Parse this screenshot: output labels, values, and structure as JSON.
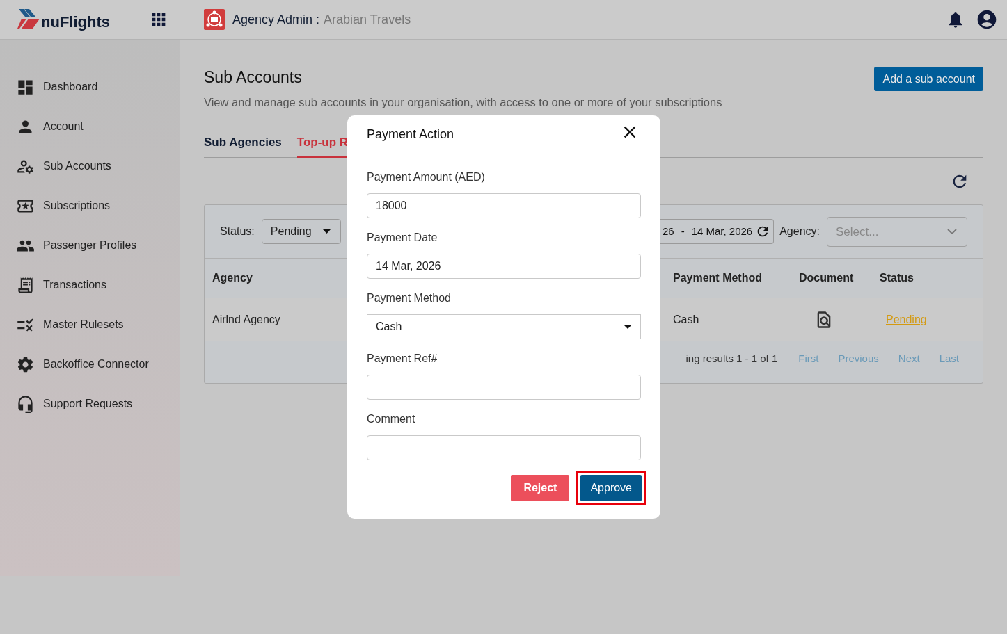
{
  "header": {
    "logo": "nuFlights",
    "title": "Agency Admin :",
    "agency": "Arabian Travels"
  },
  "sidebar": {
    "items": [
      {
        "label": "Dashboard"
      },
      {
        "label": "Account"
      },
      {
        "label": "Sub Accounts"
      },
      {
        "label": "Subscriptions"
      },
      {
        "label": "Passenger Profiles"
      },
      {
        "label": "Transactions"
      },
      {
        "label": "Master Rulesets"
      },
      {
        "label": "Backoffice Connector"
      },
      {
        "label": "Support Requests"
      }
    ]
  },
  "page": {
    "title": "Sub Accounts",
    "subtitle": "View and manage sub accounts in your organisation, with access to one or more of your subscriptions",
    "add_button": "Add a sub account"
  },
  "tabs": [
    {
      "label": "Sub Agencies",
      "selected": false
    },
    {
      "label": "Top-up R",
      "selected": true
    }
  ],
  "filters": {
    "status_label": "Status:",
    "status_value": "Pending",
    "date_start": "26",
    "date_separator": "-",
    "date_end": "14 Mar, 2026",
    "agency_label": "Agency:",
    "agency_placeholder": "Select..."
  },
  "table": {
    "columns": [
      "Agency",
      "Payment Method",
      "Document",
      "Status"
    ],
    "rows": [
      {
        "agency": "Airlnd Agency",
        "payment_method": "Cash",
        "status": "Pending"
      }
    ]
  },
  "pagination": {
    "summary": "ing results 1 - 1 of 1",
    "links": [
      "First",
      "Previous",
      "Next",
      "Last"
    ]
  },
  "dialog": {
    "title": "Payment Action",
    "fields": [
      {
        "kind": "input",
        "label": "Payment Amount (AED)",
        "value": "18000"
      },
      {
        "kind": "input",
        "label": "Payment Date",
        "value": "14 Mar, 2026"
      },
      {
        "kind": "select",
        "label": "Payment Method",
        "value": "Cash"
      },
      {
        "kind": "input",
        "label": "Payment Ref#"
      },
      {
        "kind": "input",
        "label": "Comment"
      }
    ],
    "buttons": [
      {
        "label": "Reject",
        "kind": "danger",
        "highlighted": false
      },
      {
        "label": "Approve",
        "kind": "primary",
        "highlighted": true
      }
    ]
  }
}
